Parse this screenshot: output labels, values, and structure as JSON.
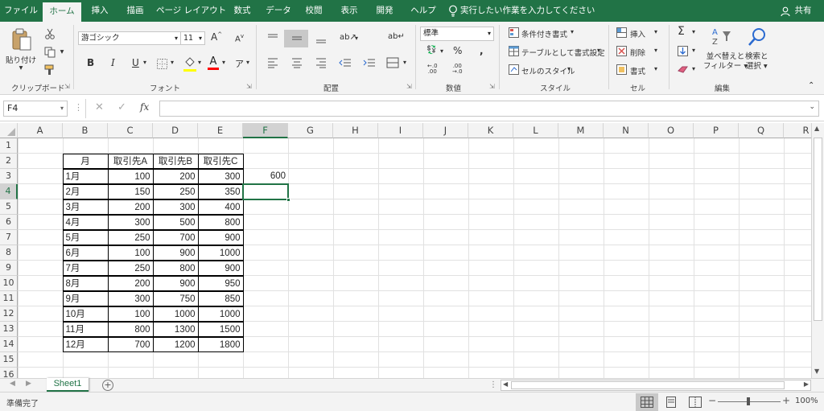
{
  "tabs": [
    "ファイル",
    "ホーム",
    "挿入",
    "描画",
    "ページ レイアウト",
    "数式",
    "データ",
    "校閲",
    "表示",
    "開発",
    "ヘルプ"
  ],
  "tell_me": "実行したい作業を入力してください",
  "share": "共有",
  "ribbon": {
    "clipboard": {
      "paste": "貼り付け",
      "label": "クリップボード"
    },
    "font": {
      "name": "游ゴシック",
      "size": "11",
      "label": "フォント"
    },
    "alignment": {
      "label": "配置"
    },
    "number": {
      "format": "標準",
      "label": "数値"
    },
    "styles": {
      "conditional": "条件付き書式",
      "table": "テーブルとして書式設定",
      "cell_styles": "セルのスタイル",
      "label": "スタイル"
    },
    "cells": {
      "insert": "挿入",
      "delete": "削除",
      "format": "書式",
      "label": "セル"
    },
    "editing": {
      "sort1": "並べ替えと",
      "sort2": "フィルター",
      "find1": "検索と",
      "find2": "選択",
      "label": "編集"
    },
    "colors": {
      "font_red": "#ff0000",
      "fill_yellow": "#ffff00",
      "accent": "#217346"
    }
  },
  "formula_bar": {
    "name_box": "F4",
    "fx": "fx",
    "formula": ""
  },
  "columns": [
    "A",
    "B",
    "C",
    "D",
    "E",
    "F",
    "G",
    "H",
    "I",
    "J",
    "K",
    "L",
    "M",
    "N",
    "O",
    "P",
    "Q",
    "R"
  ],
  "rows": [
    "1",
    "2",
    "3",
    "4",
    "5",
    "6",
    "7",
    "8",
    "9",
    "10",
    "11",
    "12",
    "13",
    "14",
    "15",
    "16"
  ],
  "selected_cell": "F4",
  "table": {
    "header": [
      "月",
      "取引先A",
      "取引先B",
      "取引先C"
    ],
    "rows": [
      [
        "1月",
        "100",
        "200",
        "300"
      ],
      [
        "2月",
        "150",
        "250",
        "350"
      ],
      [
        "3月",
        "200",
        "300",
        "400"
      ],
      [
        "4月",
        "300",
        "500",
        "800"
      ],
      [
        "5月",
        "250",
        "700",
        "900"
      ],
      [
        "6月",
        "100",
        "900",
        "1000"
      ],
      [
        "7月",
        "250",
        "800",
        "900"
      ],
      [
        "8月",
        "200",
        "900",
        "950"
      ],
      [
        "9月",
        "300",
        "750",
        "850"
      ],
      [
        "10月",
        "100",
        "1000",
        "1000"
      ],
      [
        "11月",
        "800",
        "1300",
        "1500"
      ],
      [
        "12月",
        "700",
        "1200",
        "1800"
      ]
    ]
  },
  "f3_value": "600",
  "sheets": [
    "Sheet1"
  ],
  "status": {
    "ready": "準備完了",
    "zoom": "100%"
  }
}
